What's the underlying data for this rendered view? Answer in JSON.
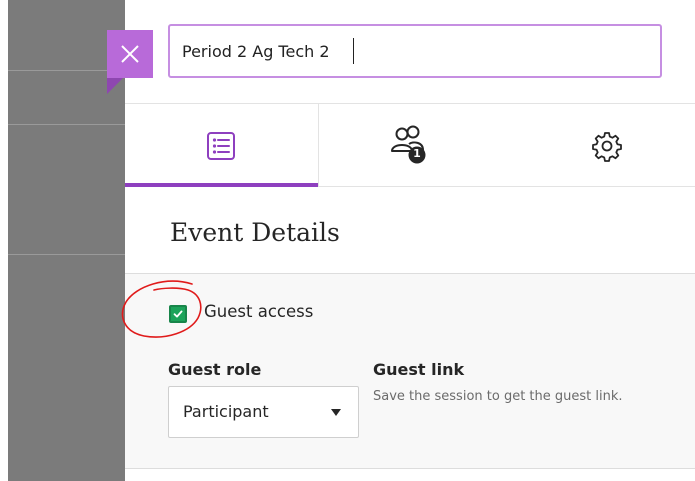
{
  "session": {
    "title_value": "Period 2 Ag Tech 2"
  },
  "tabs": [
    {
      "name": "details",
      "icon": "list-icon",
      "active": true
    },
    {
      "name": "attendees",
      "icon": "attendees-icon",
      "badge": "1"
    },
    {
      "name": "settings",
      "icon": "gear-icon"
    }
  ],
  "details": {
    "section_title": "Event Details",
    "guest_access_label": "Guest access",
    "guest_access_checked": true,
    "guest_role_label": "Guest role",
    "guest_role_value": "Participant",
    "guest_link_label": "Guest link",
    "guest_link_text": "Save the session to get the guest link."
  },
  "colors": {
    "accent": "#8e3fbf",
    "close_button": "#b86ad9",
    "checkbox": "#1ca35a",
    "annotation": "#e01b1b"
  }
}
